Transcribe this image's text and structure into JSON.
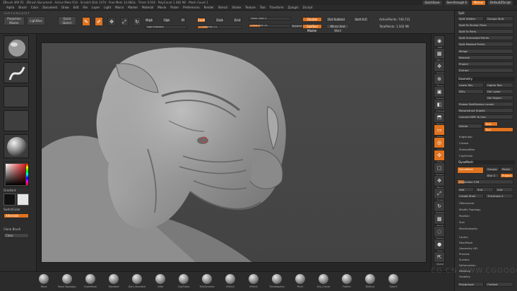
{
  "titlebar": {
    "title": "ZBrush 4R6 P2  ·  ZBrush Document  ·  Active Mem 914  ·  Scratch Disk 1474  ·  Free Mem 14.68Gb  ·  Timer 0.016  ·  PolyCount 1.482 Mil  ·  Mesh Count 1",
    "quicksave": "QuickSave",
    "seethrough": "See-through  0",
    "menus_label": "Menus",
    "default_script": "DefaultZScript"
  },
  "menubar": {
    "items": [
      "Alpha",
      "Brush",
      "Color",
      "Document",
      "Draw",
      "Edit",
      "File",
      "Layer",
      "Light",
      "Macro",
      "Marker",
      "Material",
      "Movie",
      "Picker",
      "Preferences",
      "Render",
      "Stencil",
      "Stroke",
      "Texture",
      "Tool",
      "Transform",
      "Zplugin",
      "Zscript"
    ]
  },
  "topshelf": {
    "coords": "-0.417,0.311,0.217",
    "projection_master": "Projection Master",
    "lightbox": "LightBox",
    "quick_sketch": "Quick Sketch",
    "edit": "Edit",
    "draw": "Draw",
    "move": "Move",
    "scale": "Scale",
    "rotate": "Rotate",
    "mrgb": "Mrgb",
    "rgb": "Rgb",
    "m": "M",
    "zadd": "Zadd",
    "zsub": "Zsub",
    "zcut": "Zcut",
    "rgb_intensity": "Rgb Intensity",
    "z_intensity": "Z Intensity 23",
    "z_intensity_value": 23,
    "focal_shift": "Focal Shift 0",
    "draw_size": "Draw Size 34",
    "draw_size_value": 34,
    "dynamic": "Dynamic",
    "active_points": "ActivePoints: 740,731",
    "total_points": "TotalPoints: 1.502 Mil",
    "double": "Double",
    "subtool_master": "SubTool Master",
    "dot_subtool": "Dot Subtool",
    "mirror_weld": "Mirror And Weld",
    "sort_a_z": "Sort A-Z"
  },
  "leftshelf": {
    "gradient_label": "Gradient",
    "switch_color": "SwitchColor",
    "alternate": "Alternate",
    "clone_brush": "Clone Brush",
    "clear": "Clear"
  },
  "rightshelf": {
    "tools": [
      {
        "icon": "bpr-icon",
        "label": "BPR"
      },
      {
        "icon": "spix-icon",
        "label": "SPix 3"
      },
      {
        "icon": "scroll-icon",
        "label": "Scroll"
      },
      {
        "icon": "zoom-icon",
        "label": "Zoom"
      },
      {
        "icon": "actual-icon",
        "label": "Actual"
      },
      {
        "icon": "aahalf-icon",
        "label": "AAHalf"
      },
      {
        "icon": "dynamic-persp-icon",
        "label": "Persp"
      },
      {
        "icon": "floor-icon",
        "label": "Floor"
      },
      {
        "icon": "local-icon",
        "label": "Local"
      },
      {
        "icon": "xyz-icon",
        "label": "Sym"
      },
      {
        "icon": "frame-icon",
        "label": "Frame"
      },
      {
        "icon": "move-icon",
        "label": "Move"
      },
      {
        "icon": "scale-icon",
        "label": "Scale"
      },
      {
        "icon": "rotate-icon",
        "label": "Rotate"
      },
      {
        "icon": "polyf-icon",
        "label": "PolyF"
      },
      {
        "icon": "transp-icon",
        "label": "Transp"
      },
      {
        "icon": "solo-icon",
        "label": "Solo"
      },
      {
        "icon": "xpose-icon",
        "label": "Xpose"
      }
    ]
  },
  "tray": {
    "split_header": "Split",
    "split_hidden": "Split Hidden",
    "groups_split": "Groups Split",
    "split_similar": "Split To Similar Parts",
    "split_parts": "Split To Parts",
    "split_unmasked": "Split Unmasked Points",
    "split_masked": "Split Masked Points",
    "merge": "Merge",
    "remesh": "Remesh",
    "project": "Project",
    "extract": "Extract",
    "geometry": "Geometry",
    "lower_res": "Lower Res",
    "higher_res": "Higher Res",
    "sdiv": "SDiv",
    "del_lower": "Del Lower",
    "del_higher": "Del Higher",
    "freeze": "Freeze SubDivision Levels",
    "reconstruct": "Reconstruct Subdiv",
    "convert_bpr": "Convert BPR To Geo",
    "divide": "Divide",
    "smt": "Smt",
    "suv": "Suv",
    "edgeloop": "EdgeLoop",
    "crease": "Crease",
    "shadowbox": "ShadowBox",
    "claypolish": "ClayPolish",
    "dynamesh_header": "DynaMesh",
    "dynamesh": "DynaMesh",
    "groups": "Groups",
    "polish": "Polish",
    "blur": "Blur 2",
    "project_btn": "Project",
    "resolution": "Resolution 256",
    "resolution_value": 256,
    "add": "Add",
    "sub": "Sub",
    "and": "And",
    "create_shell": "Create Shell",
    "thickness": "Thickness 4",
    "zremesher": "ZRemesher",
    "modify_topology": "Modify Topology",
    "position": "Position",
    "size": "Size",
    "mesh_integrity": "MeshIntegrity",
    "list_items": [
      "Layers",
      "FiberMesh",
      "Geometry HD",
      "Preview",
      "Surface",
      "Deformation",
      "Masking",
      "Visibility"
    ],
    "polygroups": "Polygroups",
    "contact": "Contact"
  },
  "bottomshelf": {
    "brushes": [
      "Move",
      "Move Topological",
      "SnakeHook",
      "Standard",
      "Dam_Standard",
      "Inflat",
      "ClayTubes",
      "TrimDynamic",
      "hPolish",
      "hPolish",
      "TrimAdaptive",
      "Pinch",
      "Orb_Cracks",
      "Flatten",
      "MAHcut",
      "Slash3"
    ]
  },
  "watermark": "CG.CN WWW.CGGOGO"
}
